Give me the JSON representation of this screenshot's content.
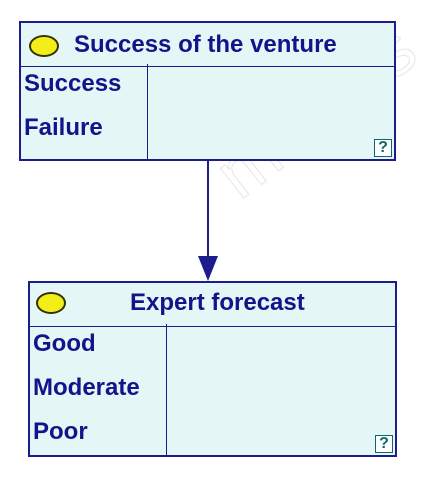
{
  "nodes": {
    "venture": {
      "title": "Success of the venture",
      "states": [
        "Success",
        "Failure"
      ],
      "help_glyph": "?"
    },
    "forecast": {
      "title": "Expert forecast",
      "states": [
        "Good",
        "Moderate",
        "Poor"
      ],
      "help_glyph": "?"
    }
  },
  "edges": [
    {
      "from": "venture",
      "to": "forecast"
    }
  ],
  "colors": {
    "node_fill": "#e4f6f6",
    "node_border": "#1c1c8c",
    "text": "#14148a",
    "oval": "#f2ee1a",
    "arrow": "#1c1c8c"
  }
}
